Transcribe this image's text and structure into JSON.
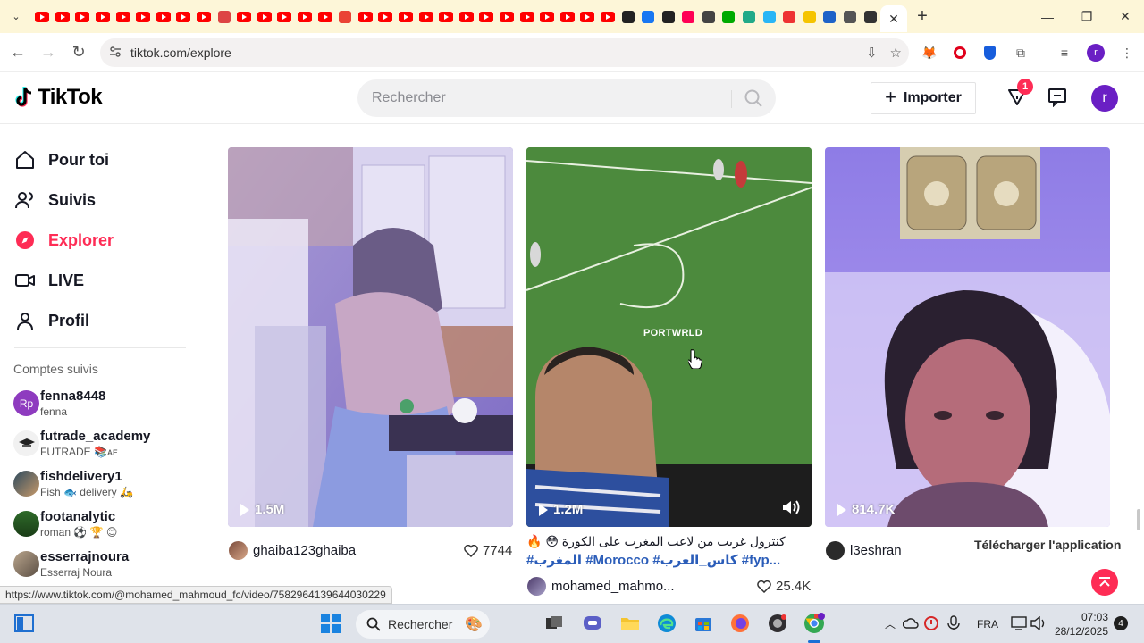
{
  "browser": {
    "active_tab_close": "✕",
    "new_tab": "+",
    "url": "tiktok.com/explore",
    "status_url": "https://www.tiktok.com/@mohamed_mahmoud_fc/video/7582964139644030229"
  },
  "header": {
    "logo_text": "TikTok",
    "search_placeholder": "Rechercher",
    "import_label": "Importer",
    "inbox_badge": "1",
    "avatar_letter": "r"
  },
  "sidebar": {
    "nav": [
      {
        "label": "Pour toi",
        "icon": "home-icon"
      },
      {
        "label": "Suivis",
        "icon": "people-icon"
      },
      {
        "label": "Explorer",
        "icon": "compass-icon"
      },
      {
        "label": "LIVE",
        "icon": "live-icon"
      },
      {
        "label": "Profil",
        "icon": "profile-icon"
      }
    ],
    "followed_title": "Comptes suivis",
    "accounts": [
      {
        "name": "fenna8448",
        "sub": "fenna",
        "avatar_text": "Rp"
      },
      {
        "name": "futrade_academy",
        "sub": "FUTRADE 📚ᴀᴇ",
        "avatar_text": ""
      },
      {
        "name": "fishdelivery1",
        "sub": "Fish 🐟 delivery 🛵",
        "avatar_text": ""
      },
      {
        "name": "footanalytic",
        "sub": "roman ⚽ 🏆 😊",
        "avatar_text": ""
      },
      {
        "name": "esserrajnoura",
        "sub": "Esserraj Noura",
        "avatar_text": ""
      }
    ]
  },
  "videos": [
    {
      "views": "1.5M",
      "author": "ghaiba123ghaiba",
      "likes": "7744"
    },
    {
      "views": "1.2M",
      "author": "mohamed_mahmo...",
      "likes": "25.4K",
      "overlay_text": "PORTWRLD",
      "caption": "كنترول غريب من لاعب المغرب على الكورة 😳 🔥",
      "hashtags": "#المغرب #Morocco #كاس_العرب #fyp..."
    },
    {
      "views": "814.7K",
      "author": "l3eshran",
      "likes": ""
    }
  ],
  "download_app": "Télécharger l'application",
  "taskbar": {
    "search_label": "Rechercher",
    "lang": "FRA",
    "time": "07:03",
    "date": "28/12/2025",
    "notif_count": "4"
  }
}
